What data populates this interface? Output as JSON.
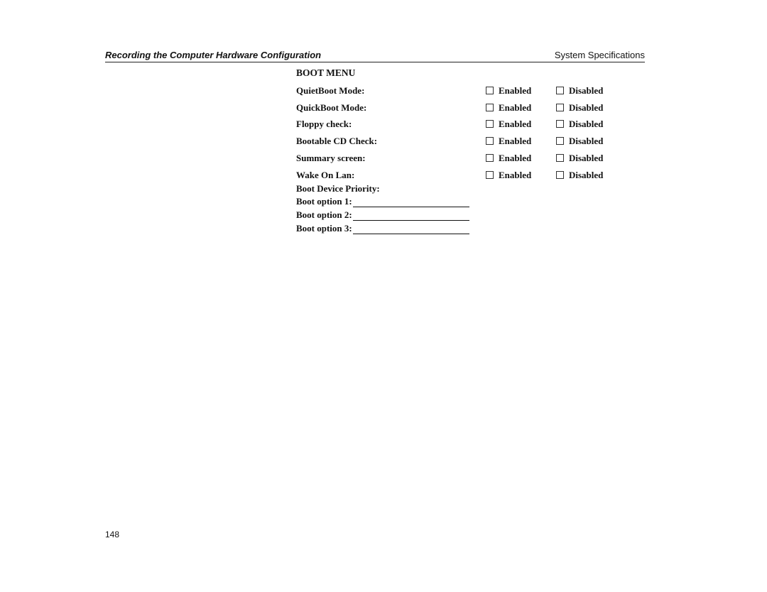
{
  "header": {
    "title": "Recording the Computer Hardware Configuration",
    "section": "System Specifications"
  },
  "boot_menu": {
    "title": "BOOT MENU",
    "option_labels": {
      "enabled": "Enabled",
      "disabled": "Disabled"
    },
    "settings": [
      {
        "label": "QuietBoot Mode:",
        "enabled_checked": false,
        "disabled_checked": false
      },
      {
        "label": "QuickBoot Mode:",
        "enabled_checked": false,
        "disabled_checked": false
      },
      {
        "label": "Floppy check:",
        "enabled_checked": false,
        "disabled_checked": false
      },
      {
        "label": "Bootable CD Check:",
        "enabled_checked": false,
        "disabled_checked": false
      },
      {
        "label": "Summary screen:",
        "enabled_checked": false,
        "disabled_checked": false
      },
      {
        "label": "Wake On Lan:",
        "enabled_checked": false,
        "disabled_checked": false
      }
    ],
    "boot_device_priority": {
      "title": "Boot Device Priority:",
      "options": [
        {
          "label": "Boot option 1:",
          "value": ""
        },
        {
          "label": "Boot option 2:",
          "value": ""
        },
        {
          "label": "Boot option 3:",
          "value": ""
        }
      ]
    }
  },
  "footer": {
    "page_number": "148"
  }
}
